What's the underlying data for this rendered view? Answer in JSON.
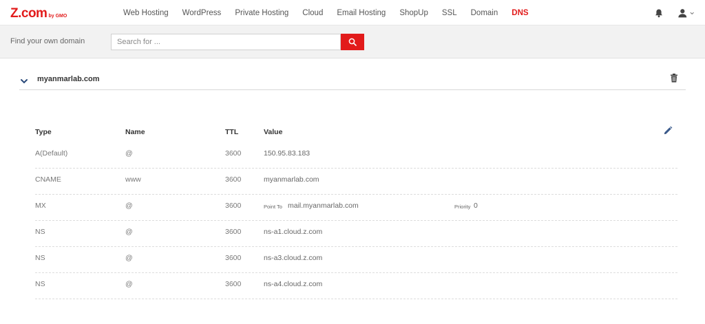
{
  "brand": {
    "logo_text": "Z.com",
    "logo_sub": "by GMO",
    "accent": "#e21b1b"
  },
  "nav": {
    "items": [
      {
        "label": "Web Hosting"
      },
      {
        "label": "WordPress"
      },
      {
        "label": "Private Hosting"
      },
      {
        "label": "Cloud"
      },
      {
        "label": "Email Hosting"
      },
      {
        "label": "ShopUp"
      },
      {
        "label": "SSL"
      },
      {
        "label": "Domain"
      },
      {
        "label": "DNS",
        "active": true
      }
    ]
  },
  "search": {
    "label": "Find your own domain",
    "placeholder": "Search for ...",
    "value": ""
  },
  "domain": {
    "name": "myanmarlab.com"
  },
  "table": {
    "headers": {
      "type": "Type",
      "name": "Name",
      "ttl": "TTL",
      "value": "Value"
    },
    "rows": [
      {
        "type": "A(Default)",
        "name": "@",
        "ttl": "3600",
        "value": "150.95.83.183"
      },
      {
        "type": "CNAME",
        "name": "www",
        "ttl": "3600",
        "value": "myanmarlab.com"
      },
      {
        "type": "MX",
        "name": "@",
        "ttl": "3600",
        "point_to_label": "Point To",
        "value": "mail.myanmarlab.com",
        "priority_label": "Priority",
        "priority": "0"
      },
      {
        "type": "NS",
        "name": "@",
        "ttl": "3600",
        "value": "ns-a1.cloud.z.com"
      },
      {
        "type": "NS",
        "name": "@",
        "ttl": "3600",
        "value": "ns-a3.cloud.z.com"
      },
      {
        "type": "NS",
        "name": "@",
        "ttl": "3600",
        "value": "ns-a4.cloud.z.com"
      }
    ]
  },
  "icons": [
    "bell-icon",
    "user-icon",
    "chevron-down-icon",
    "search-icon",
    "trash-icon",
    "pencil-icon"
  ]
}
